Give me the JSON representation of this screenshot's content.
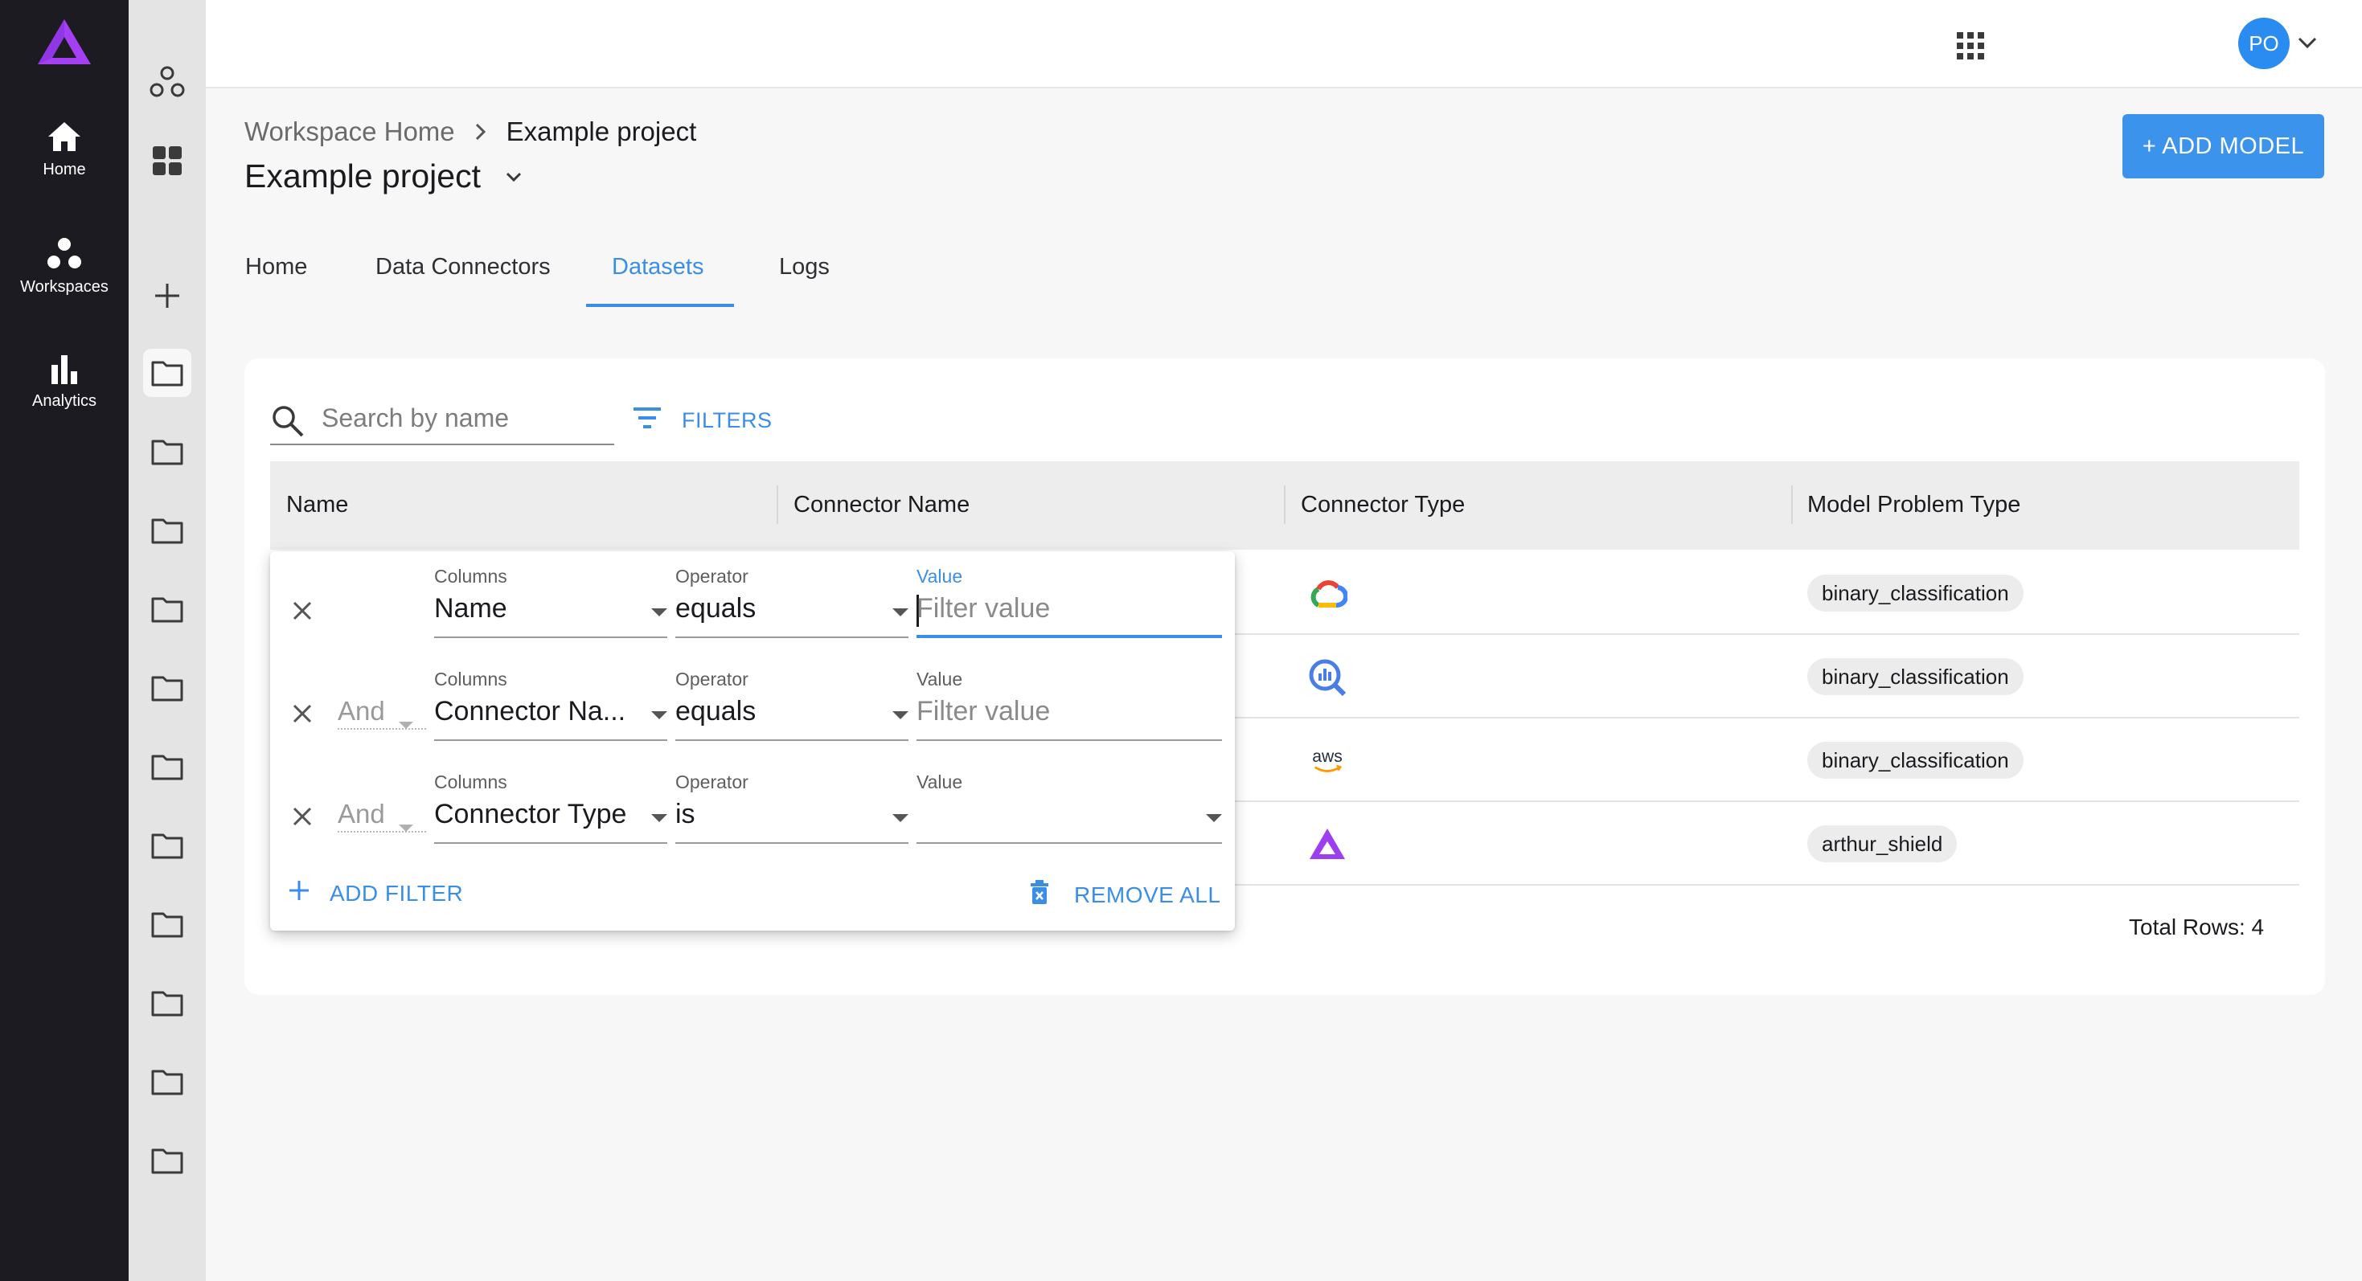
{
  "nav": {
    "items": [
      {
        "label": "Home",
        "icon": "home-icon"
      },
      {
        "label": "Workspaces",
        "icon": "workspaces-icon"
      },
      {
        "label": "Analytics",
        "icon": "analytics-icon"
      }
    ]
  },
  "topbar": {
    "avatar_initials": "PO"
  },
  "breadcrumb": {
    "root": "Workspace Home",
    "current": "Example project"
  },
  "page": {
    "title": "Example project",
    "add_model_label": "+ ADD MODEL"
  },
  "tabs": [
    {
      "label": "Home",
      "active": false
    },
    {
      "label": "Data Connectors",
      "active": false
    },
    {
      "label": "Datasets",
      "active": true
    },
    {
      "label": "Logs",
      "active": false
    }
  ],
  "search": {
    "placeholder": "Search by name"
  },
  "filters_label": "FILTERS",
  "table": {
    "columns": [
      "Name",
      "Connector Name",
      "Connector Type",
      "Model Problem Type"
    ],
    "rows": [
      {
        "connector_type_icon": "google-cloud-icon",
        "model_problem_type": "binary_classification"
      },
      {
        "connector_type_icon": "bigquery-icon",
        "model_problem_type": "binary_classification"
      },
      {
        "connector_type_icon": "aws-icon",
        "aws_text": "aws",
        "model_problem_type": "binary_classification"
      },
      {
        "connector_type_icon": "arthur-logo-icon",
        "model_problem_type": "arthur_shield"
      }
    ],
    "total_rows": "Total Rows: 4"
  },
  "filter_panel": {
    "rows": [
      {
        "logic": "",
        "column_caption": "Columns",
        "column": "Name",
        "operator_caption": "Operator",
        "operator": "equals",
        "value_caption": "Value",
        "value_placeholder": "Filter value"
      },
      {
        "logic": "And",
        "column_caption": "Columns",
        "column": "Connector Na...",
        "operator_caption": "Operator",
        "operator": "equals",
        "value_caption": "Value",
        "value_placeholder": "Filter value"
      },
      {
        "logic": "And",
        "column_caption": "Columns",
        "column": "Connector Type",
        "operator_caption": "Operator",
        "operator": "is",
        "value_caption": "Value",
        "value_placeholder": ""
      }
    ],
    "add_filter_label": "ADD FILTER",
    "remove_all_label": "REMOVE ALL"
  },
  "colors": {
    "accent": "#3b8ee6",
    "nav_bg": "#1c1b21",
    "brand_purple": "#9b3ff0"
  }
}
